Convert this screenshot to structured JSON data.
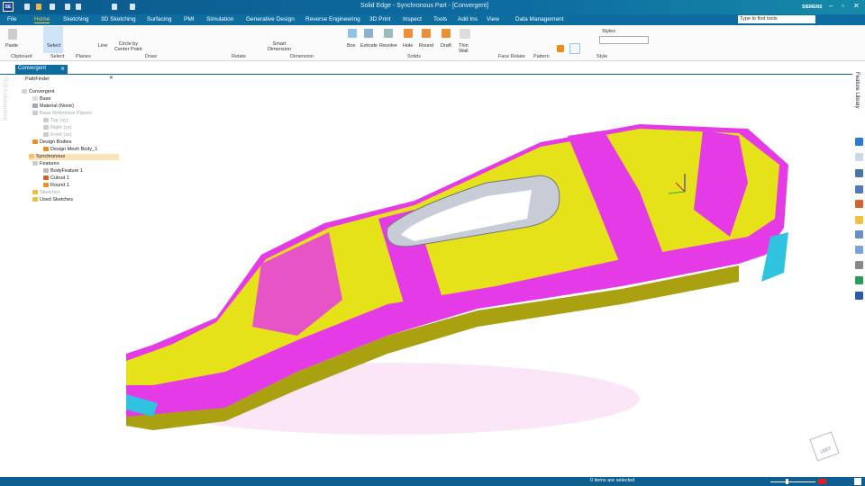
{
  "window": {
    "title": "Solid Edge - Synchronous Part - [Convergent]",
    "brand": "SIEMENS",
    "app_logo": "SE"
  },
  "menu": [
    "File",
    "Home",
    "Sketching",
    "3D Sketching",
    "Surfacing",
    "PMI",
    "Simulation",
    "Generative Design",
    "Reverse Engineering",
    "3D Print",
    "Inspect",
    "Tools",
    "Add Ins",
    "View",
    "Data Management"
  ],
  "active_menu": "Home",
  "search": {
    "placeholder": "Type to find tools"
  },
  "ribbon": {
    "buttons": [
      "Paste",
      "Select",
      "Line",
      "Circle by\nCenter Point",
      "Smart\nDimension",
      "Box",
      "Extrude",
      "Revolve",
      "Hole",
      "Round",
      "Draft",
      "Thin\nWall"
    ],
    "groups": [
      "Clipboard",
      "Select",
      "Planes",
      "Draw",
      "Relate",
      "Dimension",
      "Solids",
      "Face Relate",
      "Pattern",
      "Style"
    ],
    "styles_label": "Styles"
  },
  "document_tab": "Convergent",
  "side_tab": "PCB Collaboration",
  "pathfinder": {
    "title": "PathFinder",
    "items": [
      {
        "label": "Convergent",
        "level": 0,
        "dim": false
      },
      {
        "label": "Base",
        "level": 1,
        "dim": false
      },
      {
        "label": "Material (None)",
        "level": 1,
        "dim": false
      },
      {
        "label": "Base Reference Planes",
        "level": 1,
        "dim": true
      },
      {
        "label": "Top (xy)",
        "level": 2,
        "dim": true
      },
      {
        "label": "Right (yz)",
        "level": 2,
        "dim": true
      },
      {
        "label": "Front (xz)",
        "level": 2,
        "dim": true
      },
      {
        "label": "Design Bodies",
        "level": 1,
        "dim": false
      },
      {
        "label": "Design Mesh Body_1",
        "level": 2,
        "dim": false
      },
      {
        "label": "Synchronous",
        "level": 0,
        "dim": false
      },
      {
        "label": "Features",
        "level": 1,
        "dim": false
      },
      {
        "label": "BodyFeature 1",
        "level": 2,
        "dim": false
      },
      {
        "label": "Cutout 1",
        "level": 2,
        "dim": false
      },
      {
        "label": "Round 1",
        "level": 2,
        "dim": false
      },
      {
        "label": "Sketches",
        "level": 1,
        "dim": true
      },
      {
        "label": "Used Sketches",
        "level": 1,
        "dim": false
      }
    ]
  },
  "right_panel": {
    "tab": "Feature Library"
  },
  "view_cube": "LEFT",
  "status": {
    "text": "0 items are selected"
  },
  "colors": {
    "accent": "#0d6ca0",
    "mesh_yellow": "#e6e21a",
    "mesh_magenta": "#e53be6",
    "mesh_cyan": "#2fc3e0"
  }
}
